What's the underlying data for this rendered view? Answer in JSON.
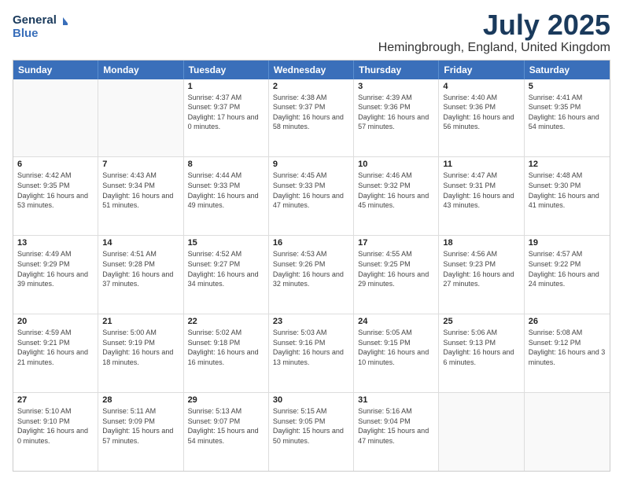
{
  "logo": {
    "line1": "General",
    "line2": "Blue"
  },
  "header": {
    "month": "July 2025",
    "location": "Hemingbrough, England, United Kingdom"
  },
  "weekdays": [
    "Sunday",
    "Monday",
    "Tuesday",
    "Wednesday",
    "Thursday",
    "Friday",
    "Saturday"
  ],
  "weeks": [
    [
      {
        "day": "",
        "sunrise": "",
        "sunset": "",
        "daylight": ""
      },
      {
        "day": "",
        "sunrise": "",
        "sunset": "",
        "daylight": ""
      },
      {
        "day": "1",
        "sunrise": "Sunrise: 4:37 AM",
        "sunset": "Sunset: 9:37 PM",
        "daylight": "Daylight: 17 hours and 0 minutes."
      },
      {
        "day": "2",
        "sunrise": "Sunrise: 4:38 AM",
        "sunset": "Sunset: 9:37 PM",
        "daylight": "Daylight: 16 hours and 58 minutes."
      },
      {
        "day": "3",
        "sunrise": "Sunrise: 4:39 AM",
        "sunset": "Sunset: 9:36 PM",
        "daylight": "Daylight: 16 hours and 57 minutes."
      },
      {
        "day": "4",
        "sunrise": "Sunrise: 4:40 AM",
        "sunset": "Sunset: 9:36 PM",
        "daylight": "Daylight: 16 hours and 56 minutes."
      },
      {
        "day": "5",
        "sunrise": "Sunrise: 4:41 AM",
        "sunset": "Sunset: 9:35 PM",
        "daylight": "Daylight: 16 hours and 54 minutes."
      }
    ],
    [
      {
        "day": "6",
        "sunrise": "Sunrise: 4:42 AM",
        "sunset": "Sunset: 9:35 PM",
        "daylight": "Daylight: 16 hours and 53 minutes."
      },
      {
        "day": "7",
        "sunrise": "Sunrise: 4:43 AM",
        "sunset": "Sunset: 9:34 PM",
        "daylight": "Daylight: 16 hours and 51 minutes."
      },
      {
        "day": "8",
        "sunrise": "Sunrise: 4:44 AM",
        "sunset": "Sunset: 9:33 PM",
        "daylight": "Daylight: 16 hours and 49 minutes."
      },
      {
        "day": "9",
        "sunrise": "Sunrise: 4:45 AM",
        "sunset": "Sunset: 9:33 PM",
        "daylight": "Daylight: 16 hours and 47 minutes."
      },
      {
        "day": "10",
        "sunrise": "Sunrise: 4:46 AM",
        "sunset": "Sunset: 9:32 PM",
        "daylight": "Daylight: 16 hours and 45 minutes."
      },
      {
        "day": "11",
        "sunrise": "Sunrise: 4:47 AM",
        "sunset": "Sunset: 9:31 PM",
        "daylight": "Daylight: 16 hours and 43 minutes."
      },
      {
        "day": "12",
        "sunrise": "Sunrise: 4:48 AM",
        "sunset": "Sunset: 9:30 PM",
        "daylight": "Daylight: 16 hours and 41 minutes."
      }
    ],
    [
      {
        "day": "13",
        "sunrise": "Sunrise: 4:49 AM",
        "sunset": "Sunset: 9:29 PM",
        "daylight": "Daylight: 16 hours and 39 minutes."
      },
      {
        "day": "14",
        "sunrise": "Sunrise: 4:51 AM",
        "sunset": "Sunset: 9:28 PM",
        "daylight": "Daylight: 16 hours and 37 minutes."
      },
      {
        "day": "15",
        "sunrise": "Sunrise: 4:52 AM",
        "sunset": "Sunset: 9:27 PM",
        "daylight": "Daylight: 16 hours and 34 minutes."
      },
      {
        "day": "16",
        "sunrise": "Sunrise: 4:53 AM",
        "sunset": "Sunset: 9:26 PM",
        "daylight": "Daylight: 16 hours and 32 minutes."
      },
      {
        "day": "17",
        "sunrise": "Sunrise: 4:55 AM",
        "sunset": "Sunset: 9:25 PM",
        "daylight": "Daylight: 16 hours and 29 minutes."
      },
      {
        "day": "18",
        "sunrise": "Sunrise: 4:56 AM",
        "sunset": "Sunset: 9:23 PM",
        "daylight": "Daylight: 16 hours and 27 minutes."
      },
      {
        "day": "19",
        "sunrise": "Sunrise: 4:57 AM",
        "sunset": "Sunset: 9:22 PM",
        "daylight": "Daylight: 16 hours and 24 minutes."
      }
    ],
    [
      {
        "day": "20",
        "sunrise": "Sunrise: 4:59 AM",
        "sunset": "Sunset: 9:21 PM",
        "daylight": "Daylight: 16 hours and 21 minutes."
      },
      {
        "day": "21",
        "sunrise": "Sunrise: 5:00 AM",
        "sunset": "Sunset: 9:19 PM",
        "daylight": "Daylight: 16 hours and 18 minutes."
      },
      {
        "day": "22",
        "sunrise": "Sunrise: 5:02 AM",
        "sunset": "Sunset: 9:18 PM",
        "daylight": "Daylight: 16 hours and 16 minutes."
      },
      {
        "day": "23",
        "sunrise": "Sunrise: 5:03 AM",
        "sunset": "Sunset: 9:16 PM",
        "daylight": "Daylight: 16 hours and 13 minutes."
      },
      {
        "day": "24",
        "sunrise": "Sunrise: 5:05 AM",
        "sunset": "Sunset: 9:15 PM",
        "daylight": "Daylight: 16 hours and 10 minutes."
      },
      {
        "day": "25",
        "sunrise": "Sunrise: 5:06 AM",
        "sunset": "Sunset: 9:13 PM",
        "daylight": "Daylight: 16 hours and 6 minutes."
      },
      {
        "day": "26",
        "sunrise": "Sunrise: 5:08 AM",
        "sunset": "Sunset: 9:12 PM",
        "daylight": "Daylight: 16 hours and 3 minutes."
      }
    ],
    [
      {
        "day": "27",
        "sunrise": "Sunrise: 5:10 AM",
        "sunset": "Sunset: 9:10 PM",
        "daylight": "Daylight: 16 hours and 0 minutes."
      },
      {
        "day": "28",
        "sunrise": "Sunrise: 5:11 AM",
        "sunset": "Sunset: 9:09 PM",
        "daylight": "Daylight: 15 hours and 57 minutes."
      },
      {
        "day": "29",
        "sunrise": "Sunrise: 5:13 AM",
        "sunset": "Sunset: 9:07 PM",
        "daylight": "Daylight: 15 hours and 54 minutes."
      },
      {
        "day": "30",
        "sunrise": "Sunrise: 5:15 AM",
        "sunset": "Sunset: 9:05 PM",
        "daylight": "Daylight: 15 hours and 50 minutes."
      },
      {
        "day": "31",
        "sunrise": "Sunrise: 5:16 AM",
        "sunset": "Sunset: 9:04 PM",
        "daylight": "Daylight: 15 hours and 47 minutes."
      },
      {
        "day": "",
        "sunrise": "",
        "sunset": "",
        "daylight": ""
      },
      {
        "day": "",
        "sunrise": "",
        "sunset": "",
        "daylight": ""
      }
    ]
  ]
}
